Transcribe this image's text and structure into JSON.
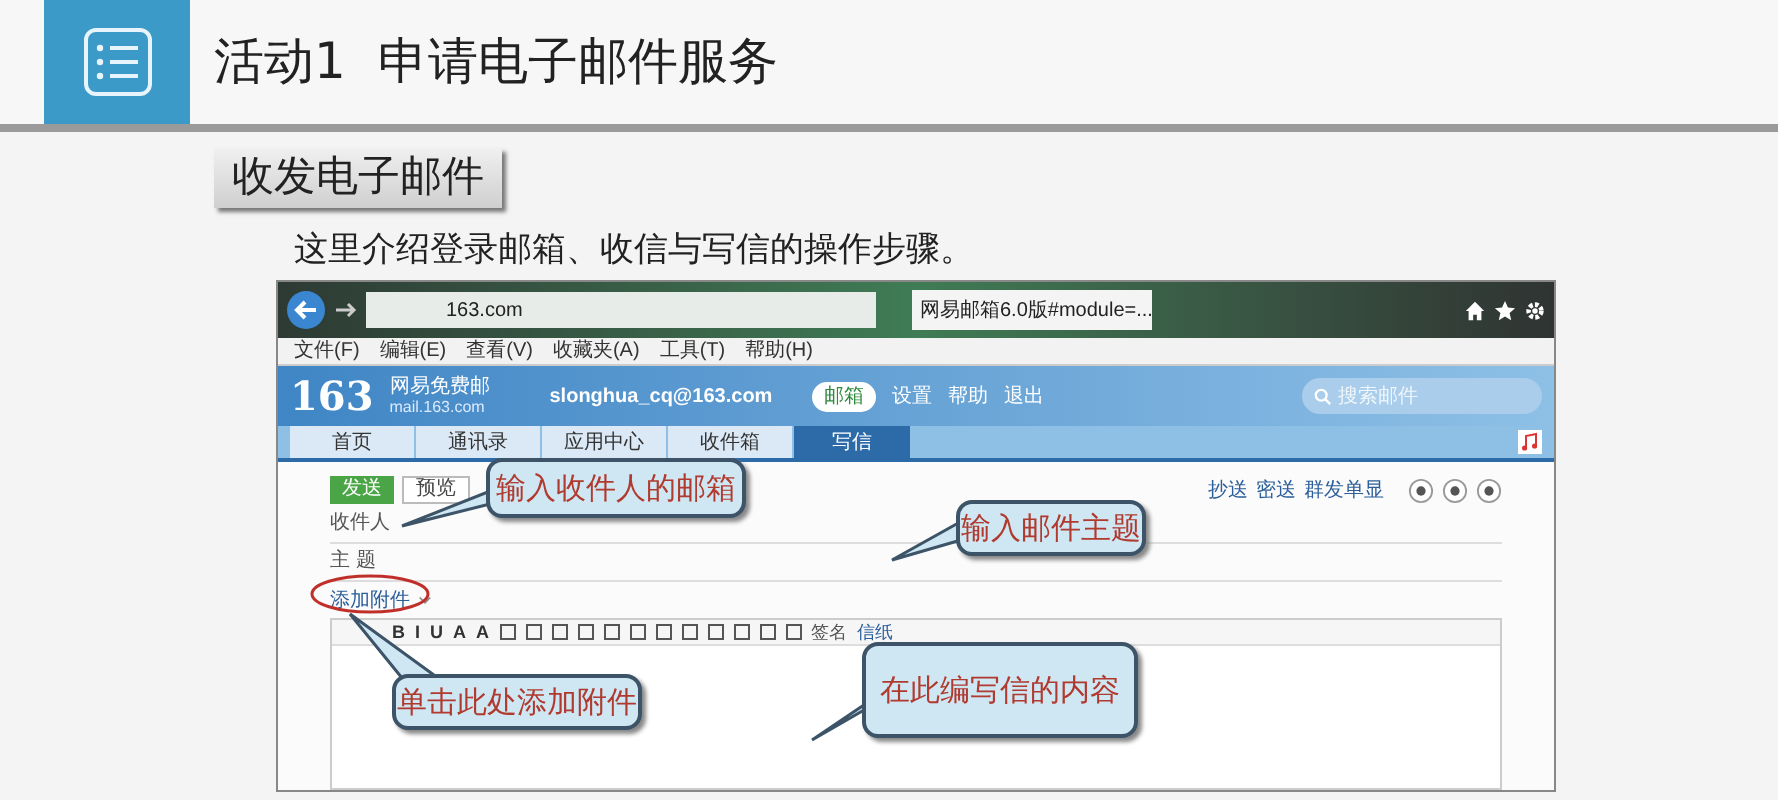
{
  "slide": {
    "title": "活动1  申请电子邮件服务",
    "section": "收发电子邮件",
    "intro": "这里介绍登录邮箱、收信与写信的操作步骤。"
  },
  "browser": {
    "address": "163.com",
    "tab_title": "网易邮箱6.0版#module=...",
    "menu": [
      "文件(F)",
      "编辑(E)",
      "查看(V)",
      "收藏夹(A)",
      "工具(T)",
      "帮助(H)"
    ]
  },
  "mail": {
    "logo": "163",
    "brand": "网易免费邮",
    "domain": "mail.163.com",
    "account": "slonghua_cq@163.com",
    "badge": "邮箱",
    "links": [
      "设置",
      "帮助",
      "退出"
    ],
    "search": {
      "placeholder": "搜索邮件"
    },
    "tabs": [
      {
        "label": "首页",
        "selected": false
      },
      {
        "label": "通讯录",
        "selected": false
      },
      {
        "label": "应用中心",
        "selected": false
      },
      {
        "label": "收件箱",
        "selected": false
      },
      {
        "label": "写信",
        "selected": true
      }
    ],
    "actions": [
      "发送",
      "预览"
    ],
    "compose_links": [
      "抄送",
      "密送",
      "群发单显"
    ],
    "fields": [
      {
        "label": "收件人"
      },
      {
        "label": "主 题"
      }
    ],
    "attachment": "添加附件",
    "format_buttons": [
      "B",
      "I",
      "U",
      "A",
      "A"
    ],
    "signature": "签名",
    "stationery": "信纸"
  },
  "callouts": [
    {
      "text": "输入收件人的邮箱"
    },
    {
      "text": "输入邮件主题"
    },
    {
      "text": "单击此处添加附件"
    },
    {
      "text": "在此编写信的内容"
    }
  ]
}
